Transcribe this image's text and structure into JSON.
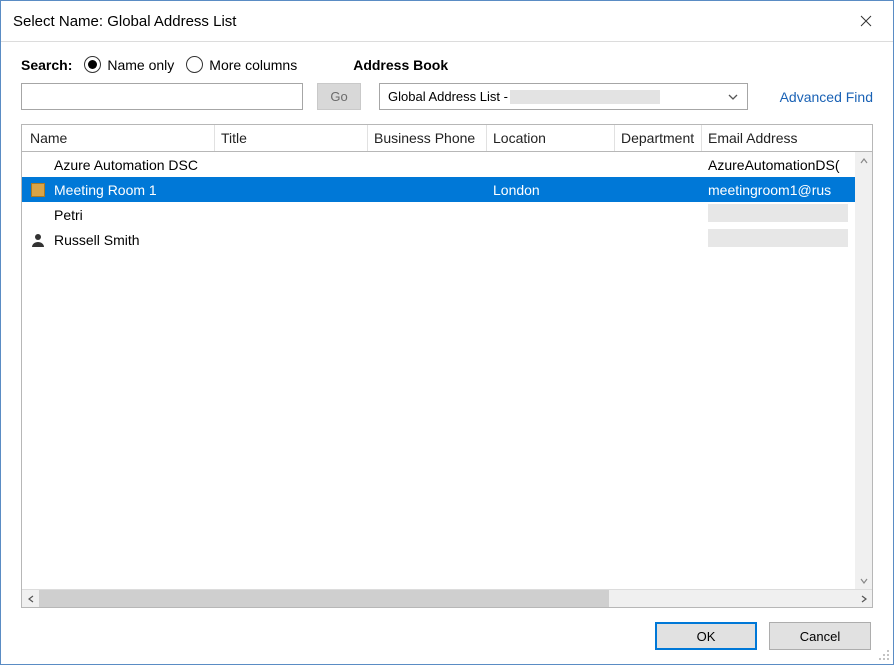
{
  "window": {
    "title": "Select Name: Global Address List"
  },
  "search": {
    "label": "Search:",
    "radio_name_only": "Name only",
    "radio_more_columns": "More columns",
    "go_label": "Go",
    "input_value": ""
  },
  "address_book": {
    "label": "Address Book",
    "selected_prefix": "Global Address List - ",
    "advanced_find": "Advanced Find"
  },
  "columns": {
    "name": "Name",
    "title": "Title",
    "phone": "Business Phone",
    "location": "Location",
    "department": "Department",
    "email": "Email Address"
  },
  "rows": [
    {
      "icon": "none",
      "name": "Azure Automation DSC",
      "title": "",
      "phone": "",
      "location": "",
      "department": "",
      "email": "AzureAutomationDS(",
      "selected": false,
      "email_redacted": false
    },
    {
      "icon": "room",
      "name": "Meeting Room 1",
      "title": "",
      "phone": "",
      "location": "London",
      "department": "",
      "email": "meetingroom1@rus",
      "selected": true,
      "email_redacted": false
    },
    {
      "icon": "none",
      "name": "Petri",
      "title": "",
      "phone": "",
      "location": "",
      "department": "",
      "email": "",
      "selected": false,
      "email_redacted": true
    },
    {
      "icon": "person",
      "name": "Russell Smith",
      "title": "",
      "phone": "",
      "location": "",
      "department": "",
      "email": "",
      "selected": false,
      "email_redacted": true
    }
  ],
  "footer": {
    "ok": "OK",
    "cancel": "Cancel"
  }
}
